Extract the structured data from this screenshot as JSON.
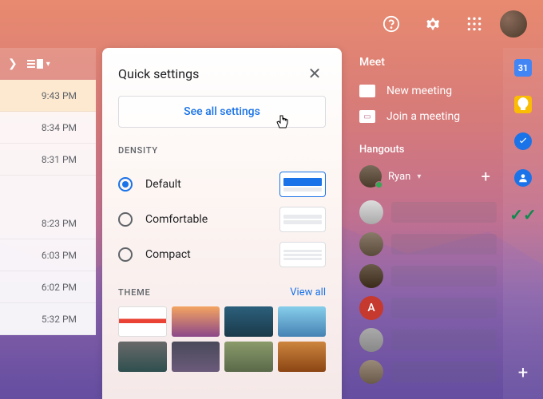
{
  "topbar": {
    "help_icon": "help-circle-icon",
    "settings_icon": "gear-icon",
    "apps_icon": "apps-grid-icon"
  },
  "times": [
    "9:43 PM",
    "8:34 PM",
    "8:31 PM",
    "",
    "8:23 PM",
    "6:03 PM",
    "6:02 PM",
    "5:32 PM"
  ],
  "panel": {
    "title": "Quick settings",
    "see_all": "See all settings",
    "density_label": "DENSITY",
    "density_options": [
      {
        "label": "Default",
        "selected": true
      },
      {
        "label": "Comfortable",
        "selected": false
      },
      {
        "label": "Compact",
        "selected": false
      }
    ],
    "theme_label": "THEME",
    "view_all": "View all"
  },
  "meet": {
    "title": "Meet",
    "new_meeting": "New meeting",
    "join_meeting": "Join a meeting"
  },
  "hangouts": {
    "title": "Hangouts",
    "user": "Ryan",
    "contacts": [
      {
        "letter": ""
      },
      {
        "letter": ""
      },
      {
        "letter": ""
      },
      {
        "letter": "A"
      },
      {
        "letter": ""
      },
      {
        "letter": ""
      }
    ]
  },
  "sidebar": {
    "calendar_day": "31"
  }
}
